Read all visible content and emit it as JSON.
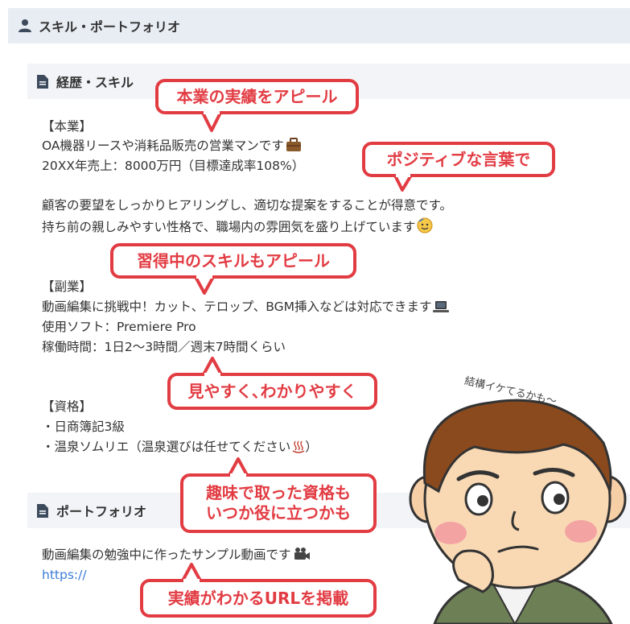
{
  "header": {
    "title": "スキル・ポートフォリオ",
    "icon": "user-icon"
  },
  "career": {
    "title": "経歴・スキル",
    "icon": "document-icon",
    "main_job_heading": "【本業】",
    "main_job_line1": "OA機器リースや消耗品販売の営業マンです",
    "main_job_line2": "20XX年売上：8000万円（目標達成率108%）",
    "strength_line1": "顧客の要望をしっかりヒアリングし、適切な提案をすることが得意です。",
    "strength_line2": "持ち前の親しみやすい性格で、職場内の雰囲気を盛り上げています",
    "side_job_heading": "【副業】",
    "side_job_line1": "動画編集に挑戦中！カット、テロップ、BGM挿入などは対応できます",
    "side_job_line2": "使用ソフト：Premiere Pro",
    "side_job_line3": "稼働時間：1日2〜3時間／週末7時間くらい",
    "qual_heading": "【資格】",
    "qual_line1": "・日商簿記3級",
    "qual_line2": "・温泉ソムリエ（温泉選びは任せてください",
    "qual_line2_end": "）"
  },
  "portfolio": {
    "title": "ポートフォリオ",
    "icon": "document-icon",
    "desc": "動画編集の勉強中に作ったサンプル動画です",
    "link": "https://"
  },
  "callouts": {
    "c1": "本業の実績をアピール",
    "c2": "ポジティブな言葉で",
    "c3": "習得中のスキルもアピール",
    "c4": "見やすく､わかりやすく",
    "c5_line1": "趣味で取った資格も",
    "c5_line2": "いつか役に立つかも",
    "c6": "実績がわかるURLを掲載"
  },
  "character": {
    "thought": "結構イケてるかも〜"
  },
  "colors": {
    "accent": "#e23c43",
    "header_bg": "#e8edf4",
    "section_bg": "#f2f4f7",
    "link": "#3a7bd5"
  },
  "icons": [
    "user-icon",
    "document-icon",
    "briefcase-icon",
    "hot-face-emoji",
    "laptop-icon",
    "hot-springs-icon",
    "video-camera-icon"
  ]
}
